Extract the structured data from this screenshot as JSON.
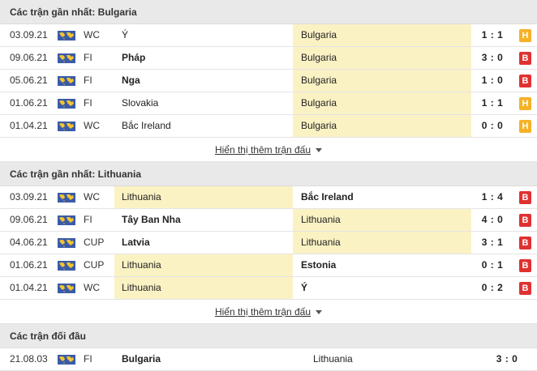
{
  "sections": [
    {
      "title": "Các trận gần nhất: Bulgaria",
      "more_label": "Hiển thị thêm trận đấu",
      "matches": [
        {
          "date": "03.09.21",
          "league": "WC",
          "home": "Ý",
          "away": "Bulgaria",
          "score": "1 : 1",
          "result": "H"
        },
        {
          "date": "09.06.21",
          "league": "FI",
          "home": "Pháp",
          "away": "Bulgaria",
          "score": "3 : 0",
          "result": "B"
        },
        {
          "date": "05.06.21",
          "league": "FI",
          "home": "Nga",
          "away": "Bulgaria",
          "score": "1 : 0",
          "result": "B"
        },
        {
          "date": "01.06.21",
          "league": "FI",
          "home": "Slovakia",
          "away": "Bulgaria",
          "score": "1 : 1",
          "result": "H"
        },
        {
          "date": "01.04.21",
          "league": "WC",
          "home": "Bắc Ireland",
          "away": "Bulgaria",
          "score": "0 : 0",
          "result": "H"
        }
      ]
    },
    {
      "title": "Các trận gần nhất: Lithuania",
      "more_label": "Hiển thị thêm trận đấu",
      "matches": [
        {
          "date": "03.09.21",
          "league": "WC",
          "home": "Lithuania",
          "away": "Bắc Ireland",
          "score": "1 : 4",
          "result": "B"
        },
        {
          "date": "09.06.21",
          "league": "FI",
          "home": "Tây Ban Nha",
          "away": "Lithuania",
          "score": "4 : 0",
          "result": "B"
        },
        {
          "date": "04.06.21",
          "league": "CUP",
          "home": "Latvia",
          "away": "Lithuania",
          "score": "3 : 1",
          "result": "B"
        },
        {
          "date": "01.06.21",
          "league": "CUP",
          "home": "Lithuania",
          "away": "Estonia",
          "score": "0 : 1",
          "result": "B"
        },
        {
          "date": "01.04.21",
          "league": "WC",
          "home": "Lithuania",
          "away": "Ý",
          "score": "0 : 2",
          "result": "B"
        }
      ]
    }
  ],
  "h2h": {
    "title": "Các trận đối đầu",
    "matches": [
      {
        "date": "21.08.03",
        "league": "FI",
        "home": "Bulgaria",
        "away": "Lithuania",
        "score": "3 : 0"
      }
    ]
  },
  "colors": {
    "highlight": "#fbf2c4",
    "draw_badge": "#f6b127",
    "loss_badge": "#e03131",
    "header_bg": "#e9e9e9"
  },
  "icons": {
    "flag": "world-map-flag-icon",
    "more": "caret-down-icon"
  }
}
